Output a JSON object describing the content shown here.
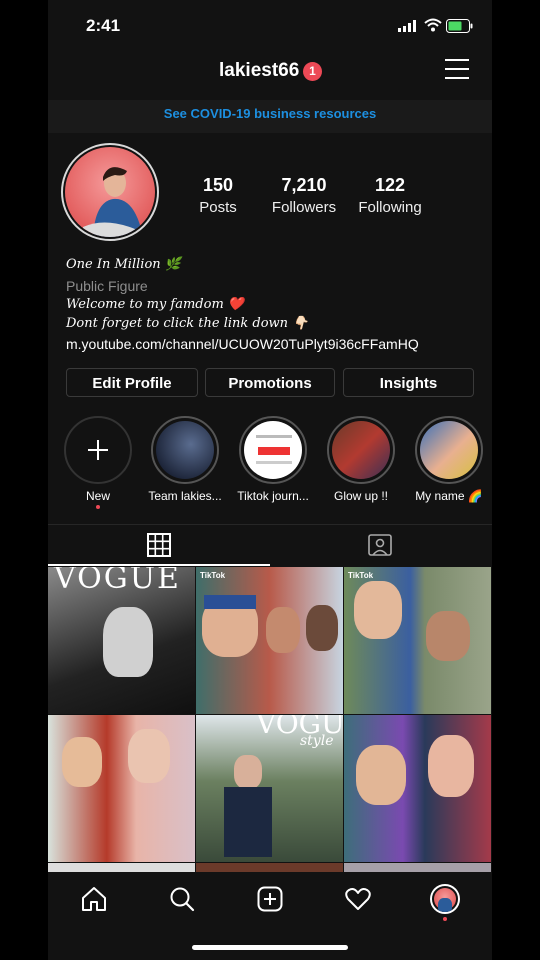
{
  "status_bar": {
    "time": "2:41"
  },
  "header": {
    "username": "lakiest66",
    "notification_count": "1"
  },
  "banner": {
    "text": "See COVID-19 business resources"
  },
  "stats": [
    {
      "value": "150",
      "label": "Posts"
    },
    {
      "value": "7,210",
      "label": "Followers"
    },
    {
      "value": "122",
      "label": "Following"
    }
  ],
  "bio": {
    "name": "One In Million 🌿",
    "category": "Public Figure",
    "line1": "Welcome to my famdom ❤️",
    "line2": "Dont forget to click the link down 👇🏻",
    "link": "m.youtube.com/channel/UCUOW20TuPlyt9i36cFFamHQ"
  },
  "buttons": {
    "edit_profile": "Edit Profile",
    "promotions": "Promotions",
    "insights": "Insights"
  },
  "highlights": [
    {
      "label": "New",
      "icon": "plus-icon"
    },
    {
      "label": "Team lakies..."
    },
    {
      "label": "Tiktok journ..."
    },
    {
      "label": "Glow up !!"
    },
    {
      "label": "My name 🌈"
    }
  ],
  "tabs": [
    {
      "icon": "grid-icon"
    },
    {
      "icon": "tagged-icon"
    }
  ],
  "grid": {
    "post1_text": "VOGUE",
    "post2_text": "TikTok",
    "post3_text": "TikTok",
    "post5_text": "VOGUE",
    "post5_sub": "style"
  },
  "nav": [
    {
      "icon": "home-icon"
    },
    {
      "icon": "search-icon"
    },
    {
      "icon": "add-post-icon"
    },
    {
      "icon": "heart-icon"
    },
    {
      "icon": "profile-avatar-icon"
    }
  ],
  "colors": {
    "accent": "#1d8fe0",
    "badge": "#ed4956",
    "background": "#121212"
  }
}
